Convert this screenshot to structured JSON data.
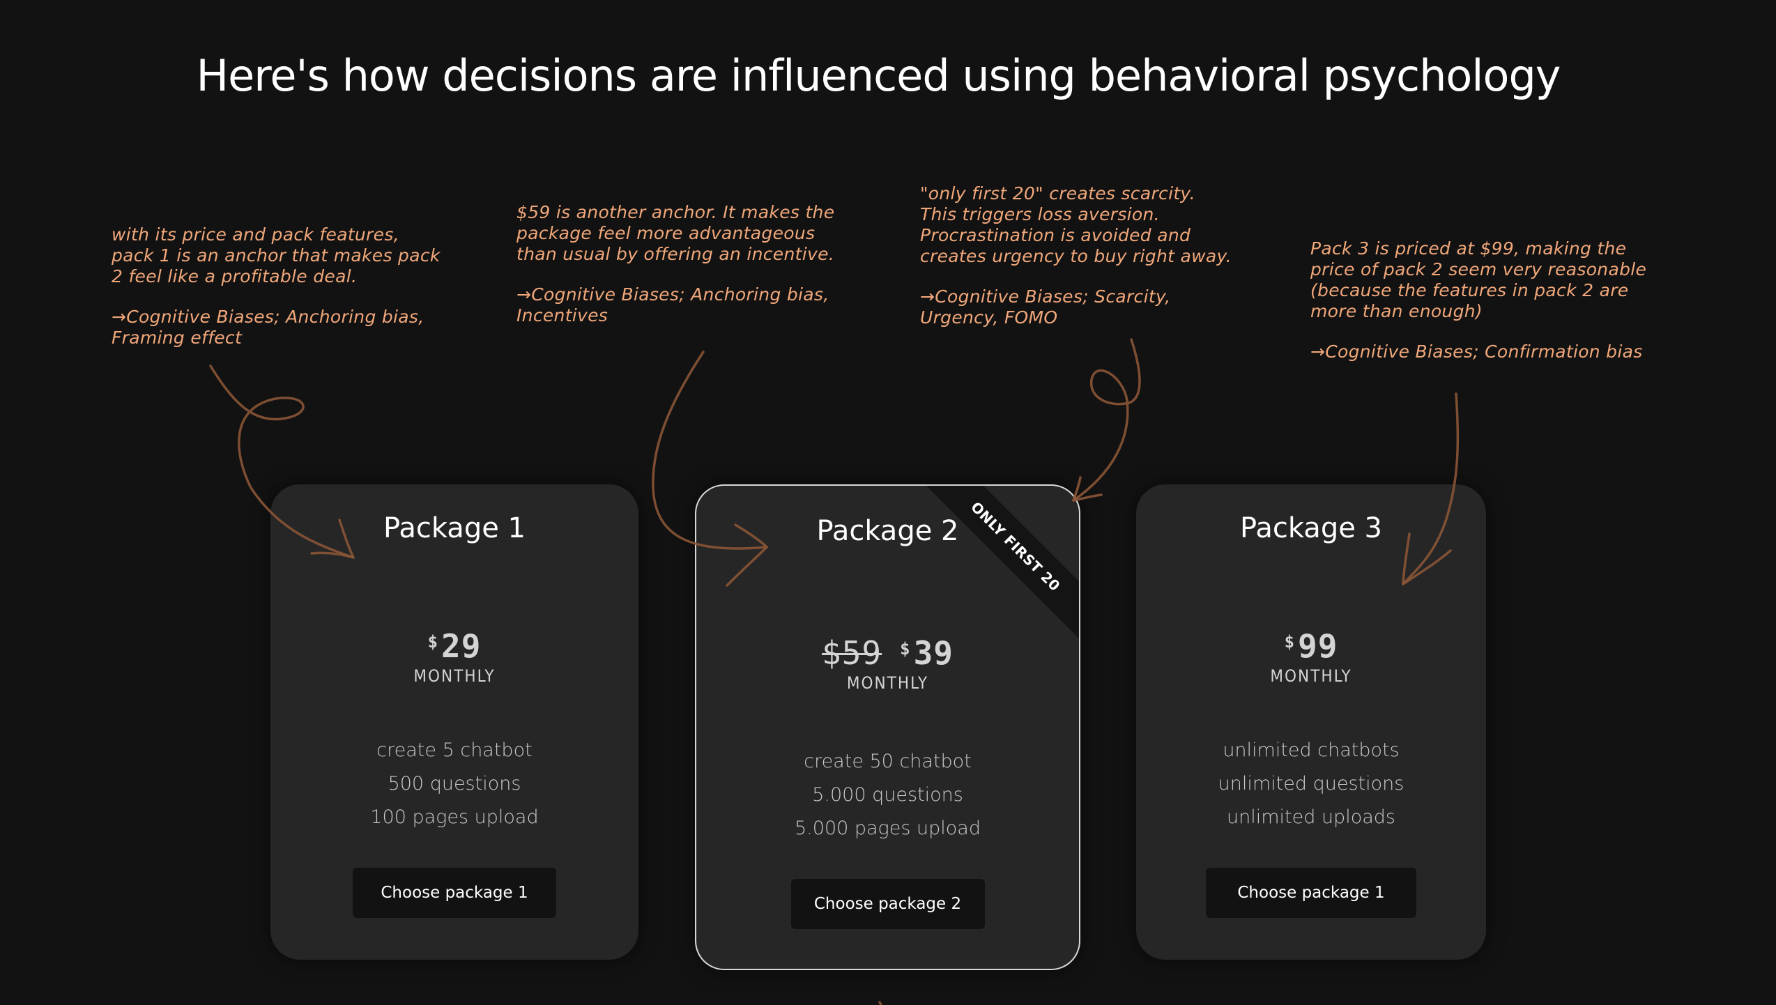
{
  "header": {
    "title": "Here's how decisions are influenced using behavioral psychology"
  },
  "annotations": [
    {
      "text": "with its price and pack features, pack 1 is an anchor that makes pack 2 feel like a profitable deal.",
      "tag": "→Cognitive Biases; Anchoring bias, Framing effect"
    },
    {
      "text": "$59 is another anchor. It makes the package feel more advantageous than usual by offering an incentive.",
      "tag": "→Cognitive Biases; Anchoring bias, Incentives"
    },
    {
      "text": "\"only first 20\" creates scarcity. This triggers loss aversion. Procrastination is avoided and creates urgency to buy right away.",
      "tag": "→Cognitive Biases; Scarcity, Urgency, FOMO"
    },
    {
      "text": "Pack 3 is priced at $99, making the price of pack 2 seem very reasonable (because the features in pack 2 are more than enough)",
      "tag": "→Cognitive Biases; Confirmation bias"
    }
  ],
  "packages": [
    {
      "title": "Package 1",
      "currency": "$",
      "price": "29",
      "period": "MONTHLY",
      "features": [
        "create 5 chatbot",
        "500 questions",
        "100 pages upload"
      ],
      "button": "Choose package 1"
    },
    {
      "title": "Package 2",
      "old_price": "$59",
      "currency": "$",
      "price": "39",
      "period": "MONTHLY",
      "ribbon": "ONLY FIRST 20",
      "features": [
        "create 50 chatbot",
        "5.000 questions",
        "5.000 pages upload"
      ],
      "button": "Choose package 2"
    },
    {
      "title": "Package 3",
      "currency": "$",
      "price": "99",
      "period": "MONTHLY",
      "features": [
        "unlimited chatbots",
        "unlimited questions",
        "unlimited uploads"
      ],
      "button": "Choose package 1"
    }
  ],
  "colors": {
    "background": "#121212",
    "card": "#262626",
    "annotation": "#f0a77a",
    "arrow": "#8a5536",
    "button": "#121212",
    "highlight_border": "#d8d8d8"
  }
}
